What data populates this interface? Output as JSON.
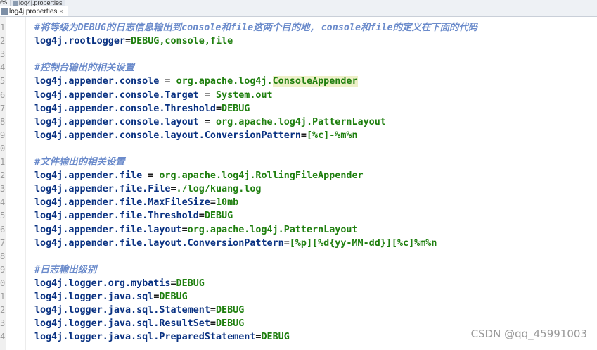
{
  "tabs": {
    "prev_tab": "es",
    "top_tab": "log4j.properties",
    "active_tab": "log4j.properties",
    "close_glyph": "×"
  },
  "lines": [
    {
      "n": "1",
      "type": "comment",
      "text": "#将等级为DEBUG的日志信息输出到console和file这两个目的地, console和file的定义在下面的代码"
    },
    {
      "n": "2",
      "type": "kv",
      "key": "log4j.rootLogger",
      "sep": "=",
      "value": "DEBUG,console,file"
    },
    {
      "n": "3",
      "type": "blank"
    },
    {
      "n": "4",
      "type": "comment",
      "text": "#控制台输出的相关设置"
    },
    {
      "n": "5",
      "type": "kv",
      "key": "log4j.appender.console",
      "sep": " = ",
      "value": "org.apache.log4j.",
      "value_hl": "ConsoleAppender"
    },
    {
      "n": "6",
      "type": "kv",
      "key": "log4j.appender.console.Target",
      "sep": " = ",
      "value": "System.out",
      "caret": true
    },
    {
      "n": "7",
      "type": "kv",
      "key": "log4j.appender.console.Threshold",
      "sep": "=",
      "value": "DEBUG"
    },
    {
      "n": "8",
      "type": "kv",
      "key": "log4j.appender.console.layout",
      "sep": " = ",
      "value": "org.apache.log4j.PatternLayout"
    },
    {
      "n": "9",
      "type": "kv",
      "key": "log4j.appender.console.layout.ConversionPattern",
      "sep": "=",
      "value": "[%c]-%m%n"
    },
    {
      "n": "0",
      "type": "blank"
    },
    {
      "n": "1",
      "type": "comment",
      "text": "#文件输出的相关设置"
    },
    {
      "n": "2",
      "type": "kv",
      "key": "log4j.appender.file",
      "sep": " = ",
      "value": "org.apache.log4j.RollingFileAppender"
    },
    {
      "n": "3",
      "type": "kv",
      "key": "log4j.appender.file.File",
      "sep": "=",
      "value": "./log/kuang.log"
    },
    {
      "n": "4",
      "type": "kv",
      "key": "log4j.appender.file.MaxFileSize",
      "sep": "=",
      "value": "10mb"
    },
    {
      "n": "5",
      "type": "kv",
      "key": "log4j.appender.file.Threshold",
      "sep": "=",
      "value": "DEBUG"
    },
    {
      "n": "6",
      "type": "kv",
      "key": "log4j.appender.file.layout",
      "sep": "=",
      "value": "org.apache.log4j.PatternLayout"
    },
    {
      "n": "7",
      "type": "kv",
      "key": "log4j.appender.file.layout.ConversionPattern",
      "sep": "=",
      "value": "[%p][%d{yy-MM-dd}][%c]%m%n"
    },
    {
      "n": "8",
      "type": "blank"
    },
    {
      "n": "9",
      "type": "comment",
      "text": "#日志输出级别"
    },
    {
      "n": "0",
      "type": "kv",
      "key": "log4j.logger.org.mybatis",
      "sep": "=",
      "value": "DEBUG"
    },
    {
      "n": "1",
      "type": "kv",
      "key": "log4j.logger.java.sql",
      "sep": "=",
      "value": "DEBUG"
    },
    {
      "n": "2",
      "type": "kv",
      "key": "log4j.logger.java.sql.Statement",
      "sep": "=",
      "value": "DEBUG"
    },
    {
      "n": "3",
      "type": "kv",
      "key": "log4j.logger.java.sql.ResultSet",
      "sep": "=",
      "value": "DEBUG"
    },
    {
      "n": "4",
      "type": "kv",
      "key": "log4j.logger.java.sql.PreparedStatement",
      "sep": "=",
      "value": "DEBUG"
    }
  ],
  "watermark": "CSDN @qq_45991003",
  "colors": {
    "key": "#0a3282",
    "value": "#1f7f0f",
    "comment": "#6b8bcb",
    "highlight": "#eef0c8"
  }
}
